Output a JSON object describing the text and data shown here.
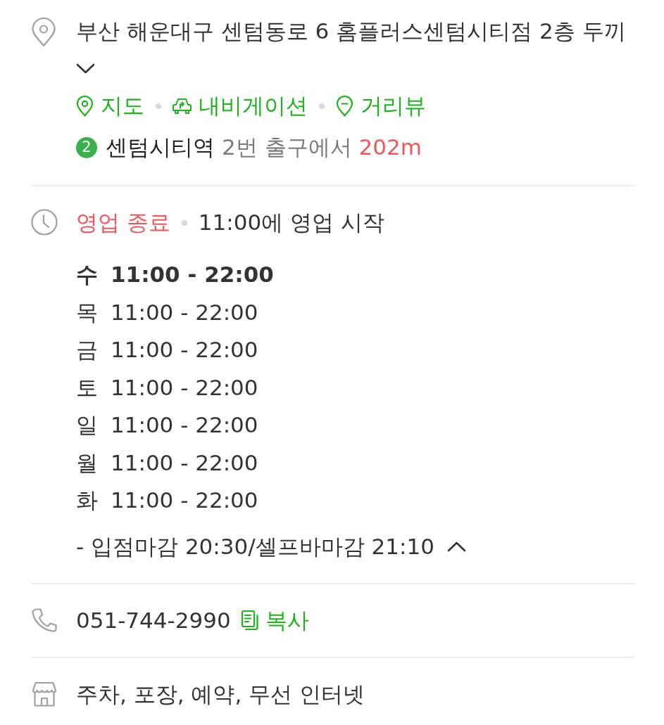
{
  "address": {
    "text": "부산 해운대구 센텀동로 6 홈플러스센텀시티점 2층 두끼",
    "expanded": false
  },
  "links": [
    {
      "kind": "map",
      "label": "지도"
    },
    {
      "kind": "navigation",
      "label": "내비게이션"
    },
    {
      "kind": "street-view",
      "label": "거리뷰"
    }
  ],
  "station": {
    "line": {
      "number": "2",
      "color": "#3bb04a"
    },
    "name": "센텀시티역",
    "exit": "2번 출구에서",
    "distance": "202m"
  },
  "hours": {
    "status": {
      "kind": "closed",
      "label": "영업 종료"
    },
    "next_open": "11:00에 영업 시작",
    "expanded": true,
    "days": [
      {
        "day": "수",
        "time": "11:00 - 22:00",
        "today": true
      },
      {
        "day": "목",
        "time": "11:00 - 22:00",
        "today": false
      },
      {
        "day": "금",
        "time": "11:00 - 22:00",
        "today": false
      },
      {
        "day": "토",
        "time": "11:00 - 22:00",
        "today": false
      },
      {
        "day": "일",
        "time": "11:00 - 22:00",
        "today": false
      },
      {
        "day": "월",
        "time": "11:00 - 22:00",
        "today": false
      },
      {
        "day": "화",
        "time": "11:00 - 22:00",
        "today": false
      }
    ],
    "note": "- 입점마감 20:30/셀프바마감 21:10"
  },
  "phone": {
    "number": "051-744-2990",
    "copy_label": "복사"
  },
  "amenities": {
    "text": "주차, 포장, 예약, 무선 인터넷"
  }
}
